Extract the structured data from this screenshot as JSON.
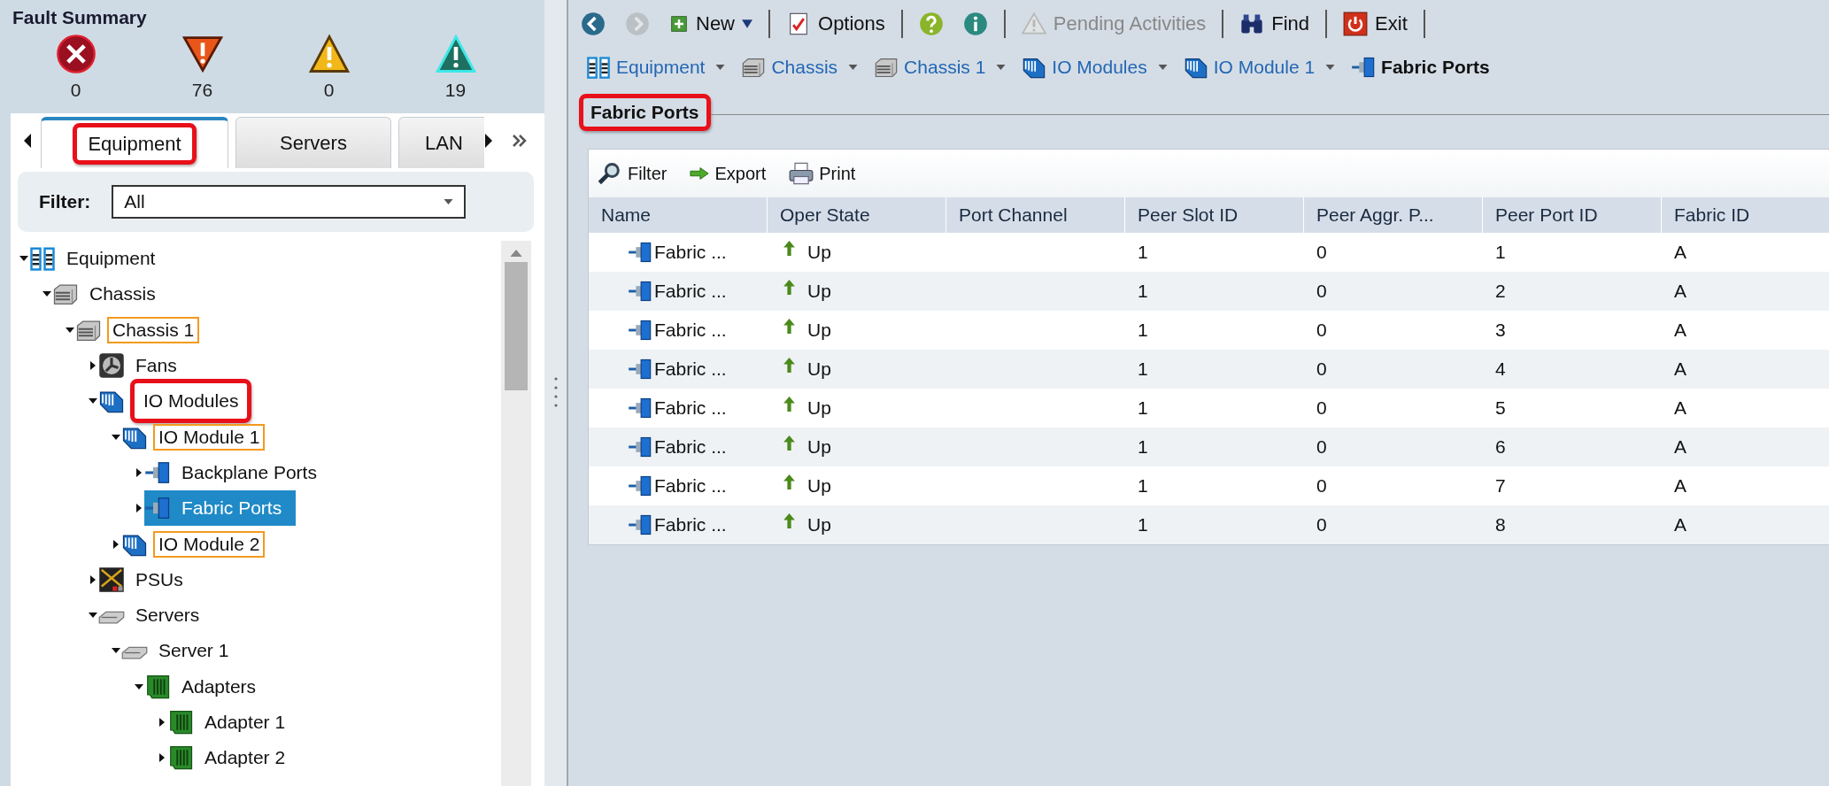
{
  "fault_summary": {
    "title": "Fault Summary",
    "counts": [
      {
        "kind": "critical",
        "count": "0"
      },
      {
        "kind": "major",
        "count": "76"
      },
      {
        "kind": "minor",
        "count": "0"
      },
      {
        "kind": "warning",
        "count": "19"
      }
    ]
  },
  "nav_tabs": [
    {
      "label": "Equipment",
      "selected": true,
      "highlighted": true
    },
    {
      "label": "Servers",
      "selected": false,
      "highlighted": false
    },
    {
      "label": "LAN",
      "selected": false,
      "highlighted": false
    }
  ],
  "filter": {
    "label": "Filter:",
    "value": "All"
  },
  "tree": [
    {
      "label": "Equipment",
      "kind": "equipment",
      "expanded": true,
      "selected": false,
      "outlined": false,
      "highlighted": false,
      "children": [
        {
          "label": "Chassis",
          "kind": "chassis",
          "expanded": true,
          "selected": false,
          "outlined": false,
          "highlighted": false,
          "children": [
            {
              "label": "Chassis 1",
              "kind": "chassis",
              "expanded": true,
              "selected": false,
              "outlined": true,
              "highlighted": false,
              "children": [
                {
                  "label": "Fans",
                  "kind": "fan",
                  "expanded": false,
                  "selected": false,
                  "outlined": false,
                  "highlighted": false
                },
                {
                  "label": "IO Modules",
                  "kind": "iomodule",
                  "expanded": true,
                  "selected": false,
                  "outlined": false,
                  "highlighted": true,
                  "children": [
                    {
                      "label": "IO Module 1",
                      "kind": "iomodule",
                      "expanded": true,
                      "selected": false,
                      "outlined": true,
                      "highlighted": false,
                      "children": [
                        {
                          "label": "Backplane Ports",
                          "kind": "port",
                          "expanded": false,
                          "selected": false,
                          "outlined": false,
                          "highlighted": false
                        },
                        {
                          "label": "Fabric Ports",
                          "kind": "port",
                          "expanded": false,
                          "selected": true,
                          "outlined": false,
                          "highlighted": false
                        }
                      ]
                    },
                    {
                      "label": "IO Module 2",
                      "kind": "iomodule",
                      "expanded": false,
                      "selected": false,
                      "outlined": true,
                      "highlighted": false
                    }
                  ]
                },
                {
                  "label": "PSUs",
                  "kind": "psu",
                  "expanded": false,
                  "selected": false,
                  "outlined": false,
                  "highlighted": false
                },
                {
                  "label": "Servers",
                  "kind": "server",
                  "expanded": true,
                  "selected": false,
                  "outlined": false,
                  "highlighted": false,
                  "children": [
                    {
                      "label": "Server 1",
                      "kind": "server",
                      "expanded": true,
                      "selected": false,
                      "outlined": false,
                      "highlighted": false,
                      "children": [
                        {
                          "label": "Adapters",
                          "kind": "adapter",
                          "expanded": true,
                          "selected": false,
                          "outlined": false,
                          "highlighted": false,
                          "children": [
                            {
                              "label": "Adapter 1",
                              "kind": "adapter",
                              "expanded": false,
                              "selected": false,
                              "outlined": false,
                              "highlighted": false
                            },
                            {
                              "label": "Adapter 2",
                              "kind": "adapter",
                              "expanded": false,
                              "selected": false,
                              "outlined": false,
                              "highlighted": false
                            }
                          ]
                        }
                      ]
                    }
                  ]
                }
              ]
            }
          ]
        }
      ]
    }
  ],
  "toolbar": [
    {
      "items": [
        {
          "kind": "back",
          "disabled": false,
          "dropdown": false
        },
        {
          "kind": "forward",
          "disabled": true,
          "dropdown": false
        },
        {
          "kind": "new",
          "label": "New",
          "disabled": false,
          "dropdown": true
        }
      ]
    },
    {
      "items": [
        {
          "kind": "options",
          "label": "Options",
          "disabled": false,
          "dropdown": false
        }
      ]
    },
    {
      "items": [
        {
          "kind": "help",
          "disabled": false,
          "dropdown": false
        },
        {
          "kind": "info",
          "disabled": false,
          "dropdown": false
        }
      ]
    },
    {
      "items": [
        {
          "kind": "pending",
          "label": "Pending Activities",
          "disabled": true,
          "dropdown": false
        }
      ]
    },
    {
      "items": [
        {
          "kind": "find",
          "label": "Find",
          "disabled": false,
          "dropdown": false
        }
      ]
    },
    {
      "items": [
        {
          "kind": "exit",
          "label": "Exit",
          "disabled": false,
          "dropdown": false
        }
      ]
    }
  ],
  "breadcrumb": [
    {
      "kind": "equipment",
      "label": "Equipment",
      "current": false
    },
    {
      "kind": "chassis",
      "label": "Chassis",
      "current": false
    },
    {
      "kind": "chassis",
      "label": "Chassis 1",
      "current": false
    },
    {
      "kind": "iomodule",
      "label": "IO Modules",
      "current": false
    },
    {
      "kind": "iomodule",
      "label": "IO Module 1",
      "current": false
    },
    {
      "kind": "port",
      "label": "Fabric Ports",
      "current": true
    }
  ],
  "content_tab": {
    "label": "Fabric Ports",
    "highlighted": true
  },
  "table_toolbar": [
    {
      "kind": "filter",
      "label": "Filter"
    },
    {
      "kind": "export",
      "label": "Export"
    },
    {
      "kind": "print",
      "label": "Print"
    }
  ],
  "table": {
    "columns": [
      "Name",
      "Oper State",
      "Port Channel",
      "Peer Slot ID",
      "Peer Aggr. P...",
      "Peer Port ID",
      "Fabric ID"
    ],
    "rows": [
      {
        "name": "Fabric ...",
        "oper_state": "Up",
        "peer_slot_id": "1",
        "peer_aggr_port": "0",
        "peer_port_id": "1",
        "fabric_id": "A"
      },
      {
        "name": "Fabric ...",
        "oper_state": "Up",
        "peer_slot_id": "1",
        "peer_aggr_port": "0",
        "peer_port_id": "2",
        "fabric_id": "A"
      },
      {
        "name": "Fabric ...",
        "oper_state": "Up",
        "peer_slot_id": "1",
        "peer_aggr_port": "0",
        "peer_port_id": "3",
        "fabric_id": "A"
      },
      {
        "name": "Fabric ...",
        "oper_state": "Up",
        "peer_slot_id": "1",
        "peer_aggr_port": "0",
        "peer_port_id": "4",
        "fabric_id": "A"
      },
      {
        "name": "Fabric ...",
        "oper_state": "Up",
        "peer_slot_id": "1",
        "peer_aggr_port": "0",
        "peer_port_id": "5",
        "fabric_id": "A"
      },
      {
        "name": "Fabric ...",
        "oper_state": "Up",
        "peer_slot_id": "1",
        "peer_aggr_port": "0",
        "peer_port_id": "6",
        "fabric_id": "A"
      },
      {
        "name": "Fabric ...",
        "oper_state": "Up",
        "peer_slot_id": "1",
        "peer_aggr_port": "0",
        "peer_port_id": "7",
        "fabric_id": "A"
      },
      {
        "name": "Fabric ...",
        "oper_state": "Up",
        "peer_slot_id": "1",
        "peer_aggr_port": "0",
        "peer_port_id": "8",
        "fabric_id": "A"
      }
    ]
  }
}
